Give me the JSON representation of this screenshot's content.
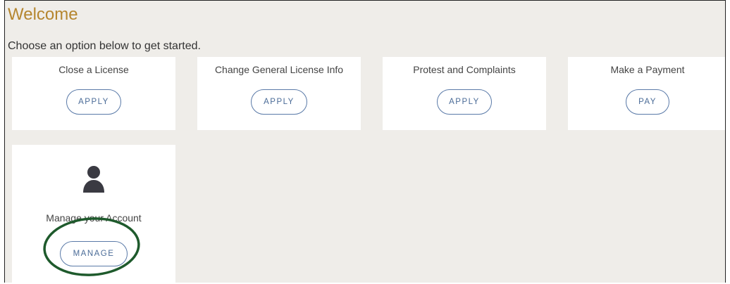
{
  "page": {
    "heading": "Welcome",
    "subtitle": "Choose an option below to get started."
  },
  "cards": [
    {
      "title": "Close a License",
      "button_label": "APPLY"
    },
    {
      "title": "Change General License Info",
      "button_label": "APPLY"
    },
    {
      "title": "Protest and Complaints",
      "button_label": "APPLY"
    },
    {
      "title": "Make a Payment",
      "button_label": "PAY"
    },
    {
      "title": "Manage your Account",
      "button_label": "MANAGE",
      "icon": "person-icon"
    }
  ],
  "colors": {
    "heading": "#b5862f",
    "button_border": "#5a7aa8",
    "highlight_circle": "#1e5a2c",
    "icon": "#3a3a42"
  }
}
